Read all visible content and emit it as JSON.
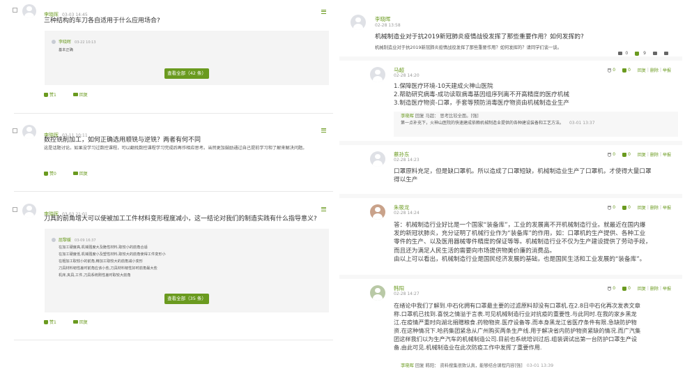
{
  "colors": {
    "accent": "#6a9a1f",
    "muted": "#999999",
    "panel": "#f4f4f4"
  },
  "left": {
    "posts": [
      {
        "author": "李晓晖",
        "date": "03-03 14:45",
        "title": "三种结构的车刀各自适用于什么应用场合?",
        "reply_author": "李晓晖",
        "reply_date": "03-22 10:13",
        "reply_lines": [
          "基本正确"
        ],
        "view_all": "查看全部（42 条）",
        "likes": "赞1",
        "reply_label": "回复"
      },
      {
        "author": "李晓晖",
        "date": "03-11 10:11",
        "title": "数控铣削加工，如何正确选用顺铣与逆铣？两者有何不同",
        "desc": "这是话题讨论。如果没学习过数控课程，可以翻找数控课程学习完成后再作相应思考。当然更加鼓励通过自己提前学习和了解来解决问题。",
        "likes": "赞0",
        "reply_label": "回复"
      },
      {
        "author": "李晓晖",
        "date": "03-03 21:01",
        "title": "刀具的前角增大可以使被加工工件材料变形程度减小，这一结论对我们的制造实践有什么指导意义?",
        "reply_author": "屈黎媛",
        "reply_date": "03-09 16:37",
        "reply_lines": [
          "在加工硬度高,机械强度大及脆性材料,取较小的前角合适",
          "在加工硬度低,机械强度小及塑性材料,取较大的前角使得工件变形小",
          "在粗加工取较小的前角,精加工取较大的前角减小变形",
          "刀具材料韧性差时前角应该小些,刀具材料韧性好时前角最大些",
          "机床,夹具,工件,刀具系统刚性差时取较大前角"
        ],
        "view_all": "查看全部（35 条）",
        "likes": "赞1",
        "reply_label": "回复"
      }
    ]
  },
  "right": {
    "header": {
      "author": "李晓晖",
      "date": "02-28 13:58",
      "title": "机械制造业对于抗2019新冠肺炎疫情战役发挥了那些重要作用？如何发挥的?",
      "desc": "机械制造业对于抗2019新冠肺炎疫情战役发挥了那些重要作用？如何发挥的？请同学们谈一谈。",
      "cups": "0",
      "likes": "9"
    },
    "ops": {
      "delete": "删除",
      "report": "举报",
      "reply": "回复",
      "sep": "|"
    },
    "answers": [
      {
        "author": "马超",
        "date": "02-28 14:20",
        "cups": "0",
        "likes": "0",
        "lines": [
          "1.保障医疗环境-10天建成火神山医院",
          "2.帮助研究病毒-成功读取病毒基因组序列离不开高精度的医疗机械",
          "3.制造医疗物资-口罩，手套等预防消毒医疗物资由机械制造业生产"
        ],
        "reply": {
          "author": "李晓晖",
          "verb": "回复",
          "target": "马超：",
          "text": "思考比较全面。[强]",
          "text2": "第一点补充下，火神山医院的快速建成依赖机械制造业提供的各种建设装备和工艺方法。",
          "date": "03-01 13:37"
        }
      },
      {
        "author": "蔡孙东",
        "date": "02-28 14:23",
        "cups": "0",
        "likes": "0",
        "lines": [
          "口罩原料充足，但是缺口罩机。所以造成了口罩短缺，机械制造业生产了口罩机，才使得大量口罩",
          "得以生产"
        ]
      },
      {
        "author": "朱筱龙",
        "date": "02-28 14:24",
        "cups": "0",
        "likes": "0",
        "lines": [
          "答：机械制造行业好比是一个国家“装备库”，工业的发展离不开机械制造行业。就最近在国内爆",
          "发的新冠状肺炎，充分证明了机械行业作为“装备库”的作用，如：口罩机的生产提供、各种工业",
          "零件的生产、以及医用器械零件精度的保证等等。机械制造行业不仅为生产建设提供了劳动手段，",
          "而且还为满足人民生活的需要向市场提供物美价廉的消费品。",
          "由以上可以看出，机械制造行业是国民经济发展的基础，也是国民生活和工业发展的“装备库”。"
        ]
      },
      {
        "author": "韩阳",
        "date": "02-28 14:27",
        "cups": "0",
        "likes": "0",
        "lines": [
          "在绪论中我们了解到.中石化拥有口罩最主要的过滤原料却没有口罩机.在2.8日中石化再次发表文章",
          "称.口罩机已找到.喜悦之情溢于言表.可见机械制造行业对抗疫的重要性.与此同时.在我的家乡黑龙",
          "江.在疫情严重时向湖北捐赠粮食.药物物资.医疗设备等.而本身黑龙江省医疗条件有限.急缺防护物",
          "资.在这种情况下.哈药集团紧急从广州购买两条生产线.用于解决省内防护物资紧缺的情况.而广汽集",
          "团这样我们以为生产汽车的机械制造公司.目前也系统培训过后.组装调试出第一台防护口罩生产设",
          "备.由此可见.机械制造业在此次防疫工作中发挥了重要作用."
        ],
        "reply": {
          "author": "李晓晖",
          "verb": "回复",
          "target": "韩阳：",
          "text": "资料搜集很致认真，能够结合课程内容[强]",
          "date": "03-01 13:39"
        }
      }
    ]
  }
}
